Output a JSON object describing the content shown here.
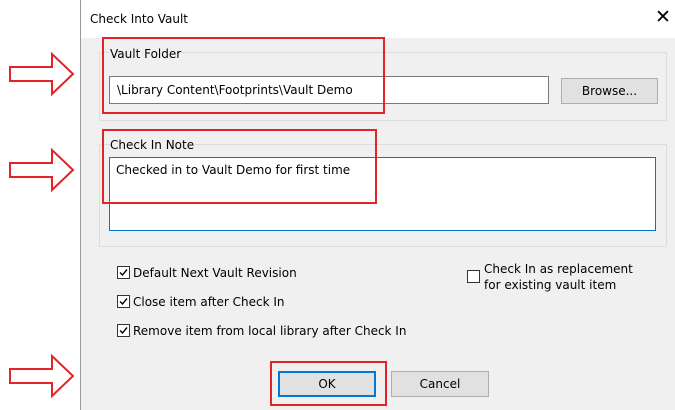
{
  "dialog": {
    "title": "Check Into Vault",
    "close_icon": "close-icon"
  },
  "vault_folder": {
    "label": "Vault Folder",
    "value": "\\Library Content\\Footprints\\Vault Demo",
    "browse_label": "Browse..."
  },
  "check_in_note": {
    "label": "Check In Note",
    "value": "Checked in to Vault Demo for first time"
  },
  "options": {
    "default_next_revision": {
      "label": "Default Next Vault Revision",
      "checked": true
    },
    "close_after_check_in": {
      "label": "Close item after Check In",
      "checked": true
    },
    "remove_from_local": {
      "label": "Remove item from local library after Check In",
      "checked": true
    },
    "replacement_line1": "Check In as replacement",
    "replacement_line2": "for existing vault item",
    "replacement_checked": false
  },
  "buttons": {
    "ok_label": "OK",
    "cancel_label": "Cancel"
  },
  "annotation": {
    "highlight_color": "#e2242a",
    "arrow_icon": "right-arrow-icon"
  }
}
